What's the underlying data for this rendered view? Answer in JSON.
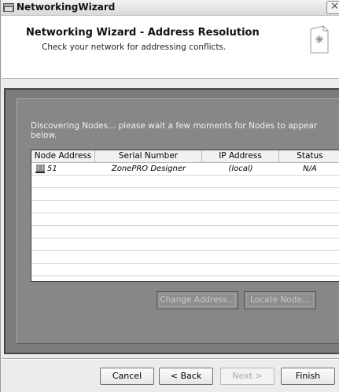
{
  "window": {
    "title": "NetworkingWizard"
  },
  "header": {
    "title": "Networking Wizard - Address Resolution",
    "subtitle": "Check your network for addressing conflicts."
  },
  "panel": {
    "message": "Discovering Nodes... please wait a few moments for Nodes to appear below.",
    "table": {
      "columns": [
        "Node Address",
        "Serial Number",
        "IP Address",
        "Status"
      ],
      "rows": [
        {
          "node_address": "51",
          "serial_number": "ZonePRO Designer",
          "ip_address": "(local)",
          "status": "N/A"
        }
      ]
    },
    "buttons": {
      "change_address": "Change Address...",
      "locate_node": "Locate Node..."
    }
  },
  "footer": {
    "cancel": "Cancel",
    "back": "< Back",
    "next": "Next >",
    "finish": "Finish"
  },
  "icons": {
    "app": "network-app-icon",
    "close": "close-icon",
    "wizard": "wizard-document-icon",
    "node": "computer-node-icon"
  }
}
